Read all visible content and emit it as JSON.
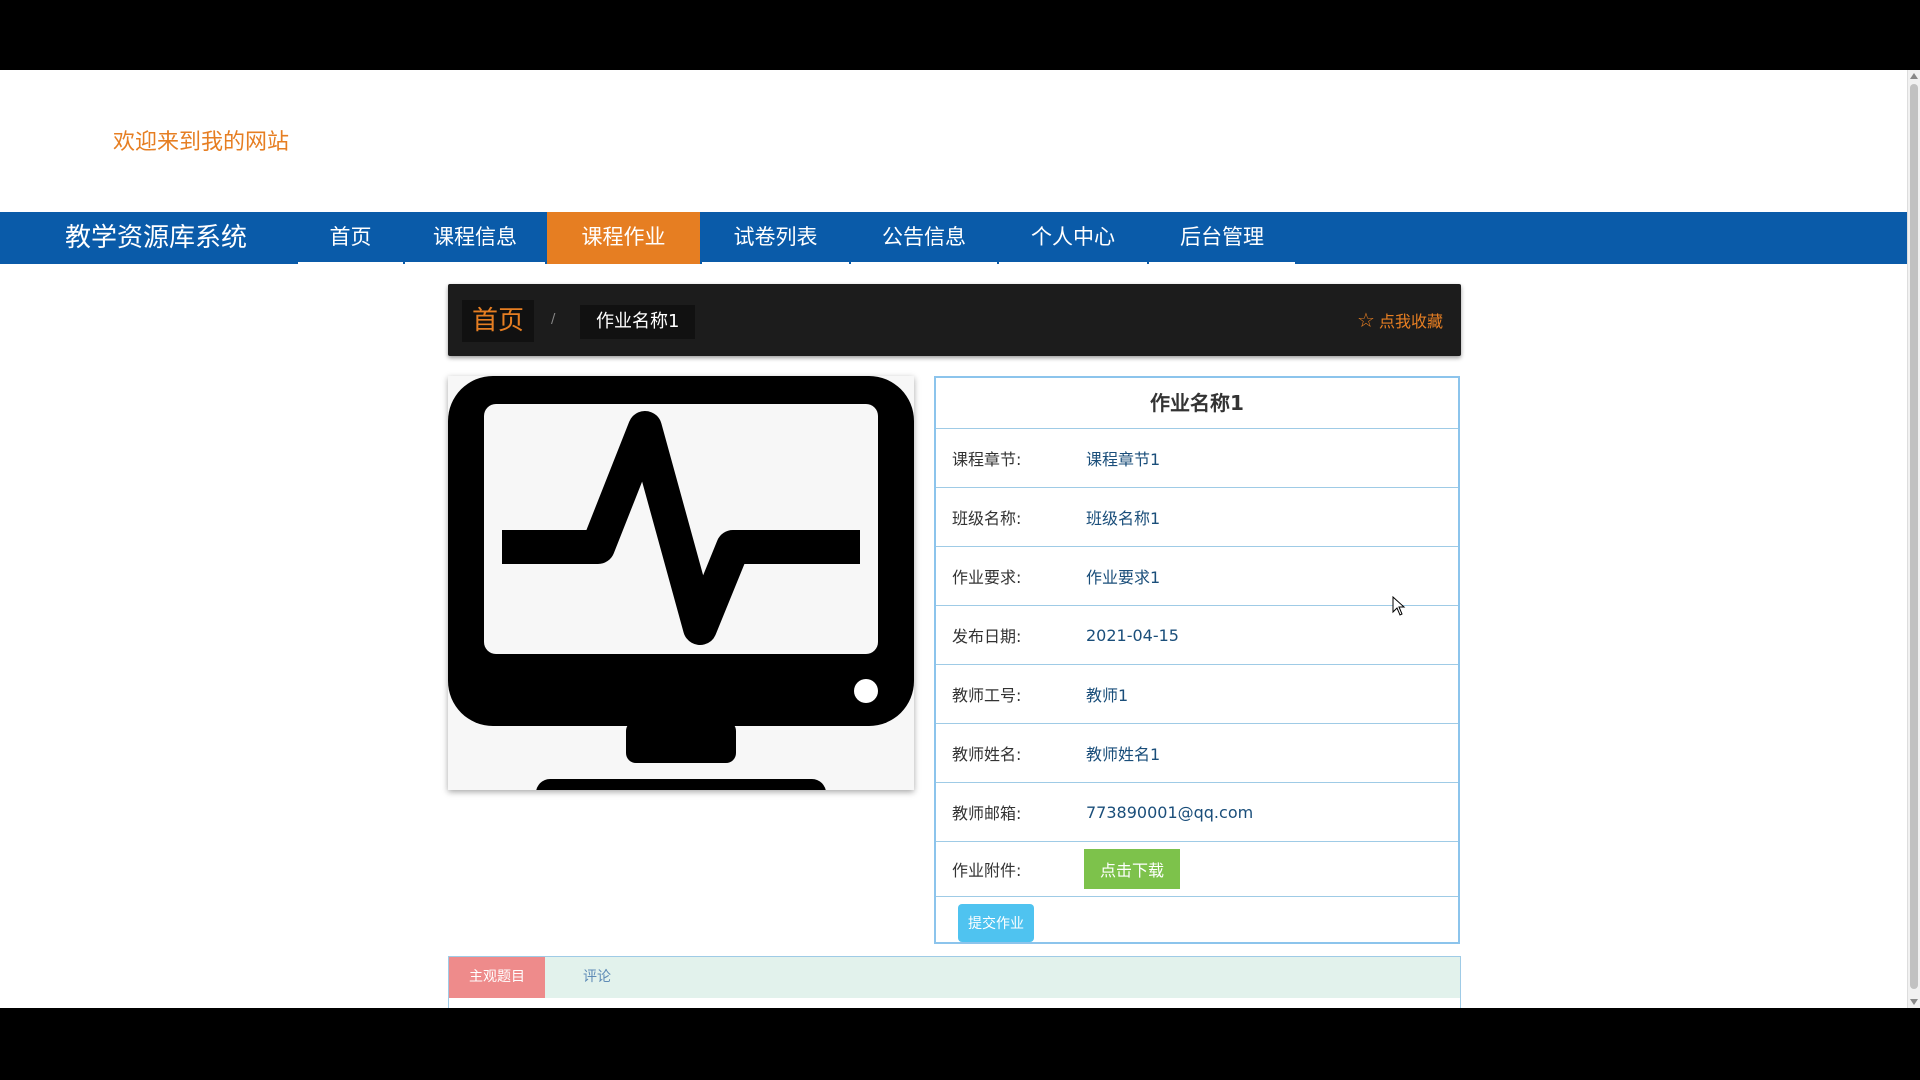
{
  "header": {
    "welcome": "欢迎来到我的网站"
  },
  "nav": {
    "brand": "教学资源库系统",
    "items": [
      {
        "label": "首页"
      },
      {
        "label": "课程信息"
      },
      {
        "label": "课程作业"
      },
      {
        "label": "试卷列表"
      },
      {
        "label": "公告信息"
      },
      {
        "label": "个人中心"
      },
      {
        "label": "后台管理"
      }
    ],
    "active_index": 2
  },
  "breadcrumb": {
    "home": "首页",
    "separator": "/",
    "current": "作业名称1",
    "favorite": "点我收藏"
  },
  "image": {
    "icon": "monitor-heartbeat-icon"
  },
  "detail": {
    "title": "作业名称1",
    "rows": [
      {
        "label": "课程章节:",
        "value": "课程章节1"
      },
      {
        "label": "班级名称:",
        "value": "班级名称1"
      },
      {
        "label": "作业要求:",
        "value": "作业要求1"
      },
      {
        "label": "发布日期:",
        "value": "2021-04-15"
      },
      {
        "label": "教师工号:",
        "value": "教师1"
      },
      {
        "label": "教师姓名:",
        "value": "教师姓名1"
      },
      {
        "label": "教师邮箱:",
        "value": "773890001@qq.com"
      }
    ],
    "attachment_label": "作业附件:",
    "download_label": "点击下载",
    "submit_label": "提交作业"
  },
  "tabs": [
    {
      "label": "主观题目"
    },
    {
      "label": "评论"
    }
  ],
  "colors": {
    "nav_bg": "#0a5ba9",
    "accent": "#e67e22",
    "download": "#7dc24b",
    "submit": "#4fc3f0",
    "tab_active": "#ee8b8b"
  }
}
